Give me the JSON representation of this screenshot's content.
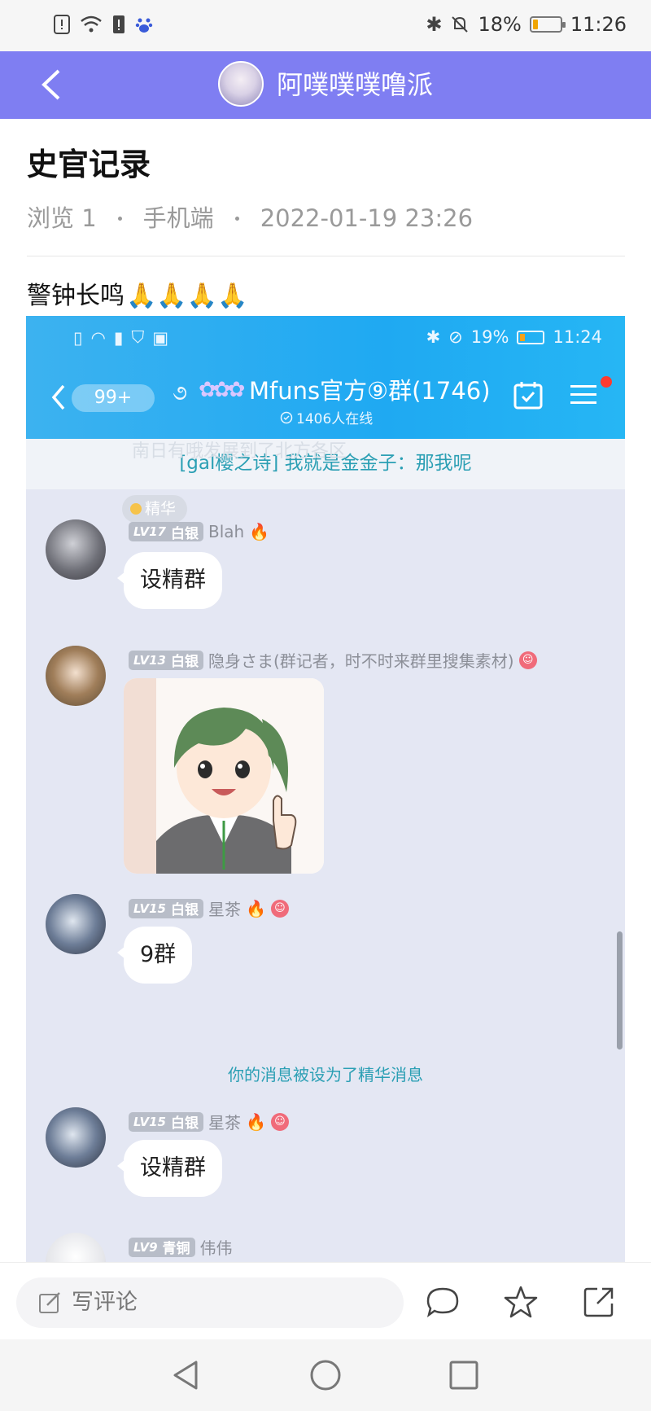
{
  "status_bar": {
    "battery": "18%",
    "time": "11:26",
    "battery_level": 0.18
  },
  "header": {
    "title": "阿噗噗噗噜派"
  },
  "post": {
    "title": "史官记录",
    "views": "浏览 1",
    "device": "手机端",
    "datetime": "2022-01-19 23:26",
    "text": "警钟长鸣",
    "emoji": "🙏🙏🙏🙏"
  },
  "screenshot": {
    "status": {
      "battery": "19%",
      "time": "11:24",
      "battery_level": 0.19
    },
    "unread_badge": "99+",
    "group_title": "Mfuns官方⑨群(1746)",
    "online": "1406人在线",
    "notice": "[gal樱之诗] 我就是金金子：那我呢",
    "notice_ghost": "南日有哦发展到了北方各区",
    "pill": "精华",
    "messages": [
      {
        "lv": "LV17",
        "rank": "白银",
        "name": "Blah",
        "text": "设精群"
      },
      {
        "lv": "LV13",
        "rank": "白银",
        "name": "隐身さま(群记者，时不时来群里搜集素材)"
      },
      {
        "lv": "LV15",
        "rank": "白银",
        "name": "星茶",
        "text": "9群"
      },
      {
        "lv": "LV15",
        "rank": "白银",
        "name": "星茶",
        "text": "设精群"
      },
      {
        "lv": "LV9",
        "rank": "青铜",
        "name": "伟伟"
      }
    ],
    "system_message": "你的消息被设为了精华消息"
  },
  "bottom_bar": {
    "comment_placeholder": "写评论"
  },
  "icons": {
    "back": "back-arrow-icon",
    "comment": "comment-bubble-icon",
    "star": "star-icon",
    "share": "share-icon",
    "edit": "edit-icon"
  },
  "colors": {
    "header": "#7f7ef2",
    "embedded_header": "#1fa9f2",
    "link_teal": "#2b9fb4"
  }
}
